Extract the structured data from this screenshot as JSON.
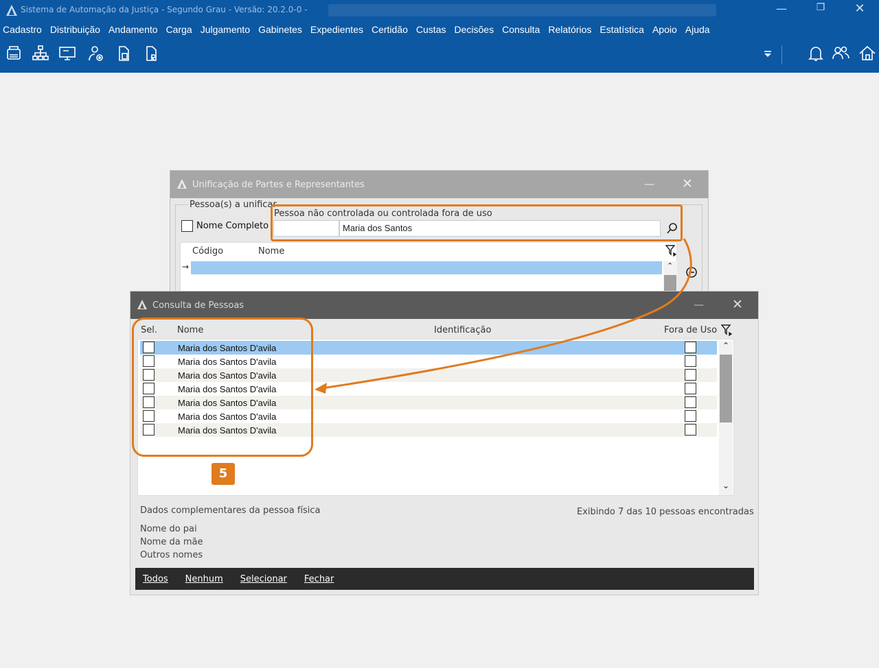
{
  "window": {
    "title": "Sistema de Automação da Justiça - Segundo Grau - Versão: 20.2.0-0 -",
    "minimize_glyph": "—",
    "restore_glyph": "❐",
    "close_glyph": "✕"
  },
  "menu": [
    "Cadastro",
    "Distribuição",
    "Andamento",
    "Carga",
    "Julgamento",
    "Gabinetes",
    "Expedientes",
    "Certidão",
    "Custas",
    "Decisões",
    "Consulta",
    "Relatórios",
    "Estatística",
    "Apoio",
    "Ajuda"
  ],
  "toolbar_icons": [
    "printer-icon",
    "org-chart-icon",
    "monitor-icon",
    "user-settings-icon",
    "document-copy-icon",
    "document-r-icon"
  ],
  "toolbar_right_icons": [
    "dropdown-icon",
    "bell-icon",
    "users-icon",
    "home-icon"
  ],
  "dialog_unificacao": {
    "title": "Unificação de Partes e Representantes",
    "group_label": "Pessoa(s) a unificar",
    "nome_completo_label": "Nome Completo",
    "pessoa_label": "Pessoa não controlada ou controlada fora de uso",
    "search_value": "Maria dos Santos",
    "col_codigo": "Código",
    "col_nome": "Nome",
    "row_arrow": "→"
  },
  "dialog_consulta": {
    "title": "Consulta de Pessoas",
    "col_sel": "Sel.",
    "col_nome": "Nome",
    "col_identificacao": "Identificação",
    "col_fora_de_uso": "Fora de Uso",
    "rows": [
      {
        "nome": "Maria dos Santos D'avila"
      },
      {
        "nome": "Maria dos Santos D'avila"
      },
      {
        "nome": "Maria dos Santos D'avila"
      },
      {
        "nome": "Maria dos Santos D'avila"
      },
      {
        "nome": "Maria dos Santos D'avila"
      },
      {
        "nome": "Maria dos Santos D'avila"
      },
      {
        "nome": "Maria dos Santos D'avila"
      }
    ],
    "badge": "5",
    "dados_label": "Dados complementares da pessoa física",
    "exibindo": "Exibindo 7 das 10 pessoas encontradas",
    "nome_pai": "Nome do pai",
    "nome_mae": "Nome da mãe",
    "outros_nomes": "Outros nomes",
    "buttons": {
      "todos": "Todos",
      "nenhum": "Nenhum",
      "selecionar": "Selecionar",
      "fechar": "Fechar"
    }
  },
  "colors": {
    "accent": "#0c58a3",
    "highlight": "#e07b1f",
    "selected_row": "#9ccaf3"
  }
}
